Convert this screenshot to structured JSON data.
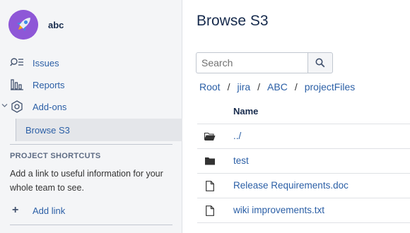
{
  "sidebar": {
    "project_name": "abc",
    "items": [
      {
        "label": "Issues",
        "icon": "issues-search-icon"
      },
      {
        "label": "Reports",
        "icon": "reports-bar-icon"
      },
      {
        "label": "Add-ons",
        "icon": "hexagon-gear-icon"
      }
    ],
    "subitem": {
      "label": "Browse S3"
    },
    "shortcuts": {
      "title": "PROJECT SHORTCUTS",
      "description": "Add a link to useful information for your whole team to see.",
      "add_link": "Add link"
    }
  },
  "main": {
    "title": "Browse S3",
    "search": {
      "placeholder": "Search",
      "value": ""
    },
    "breadcrumb": [
      "Root",
      "jira",
      "ABC",
      "projectFiles"
    ],
    "table": {
      "header": "Name",
      "rows": [
        {
          "name": "../",
          "type": "folder-open"
        },
        {
          "name": "test",
          "type": "folder"
        },
        {
          "name": "Release Requirements.doc",
          "type": "file"
        },
        {
          "name": "wiki improvements.txt",
          "type": "file"
        }
      ]
    }
  },
  "colors": {
    "link": "#2b5fa6",
    "avatar": "#8e57d7",
    "sidebar_bg": "#f4f5f7"
  }
}
